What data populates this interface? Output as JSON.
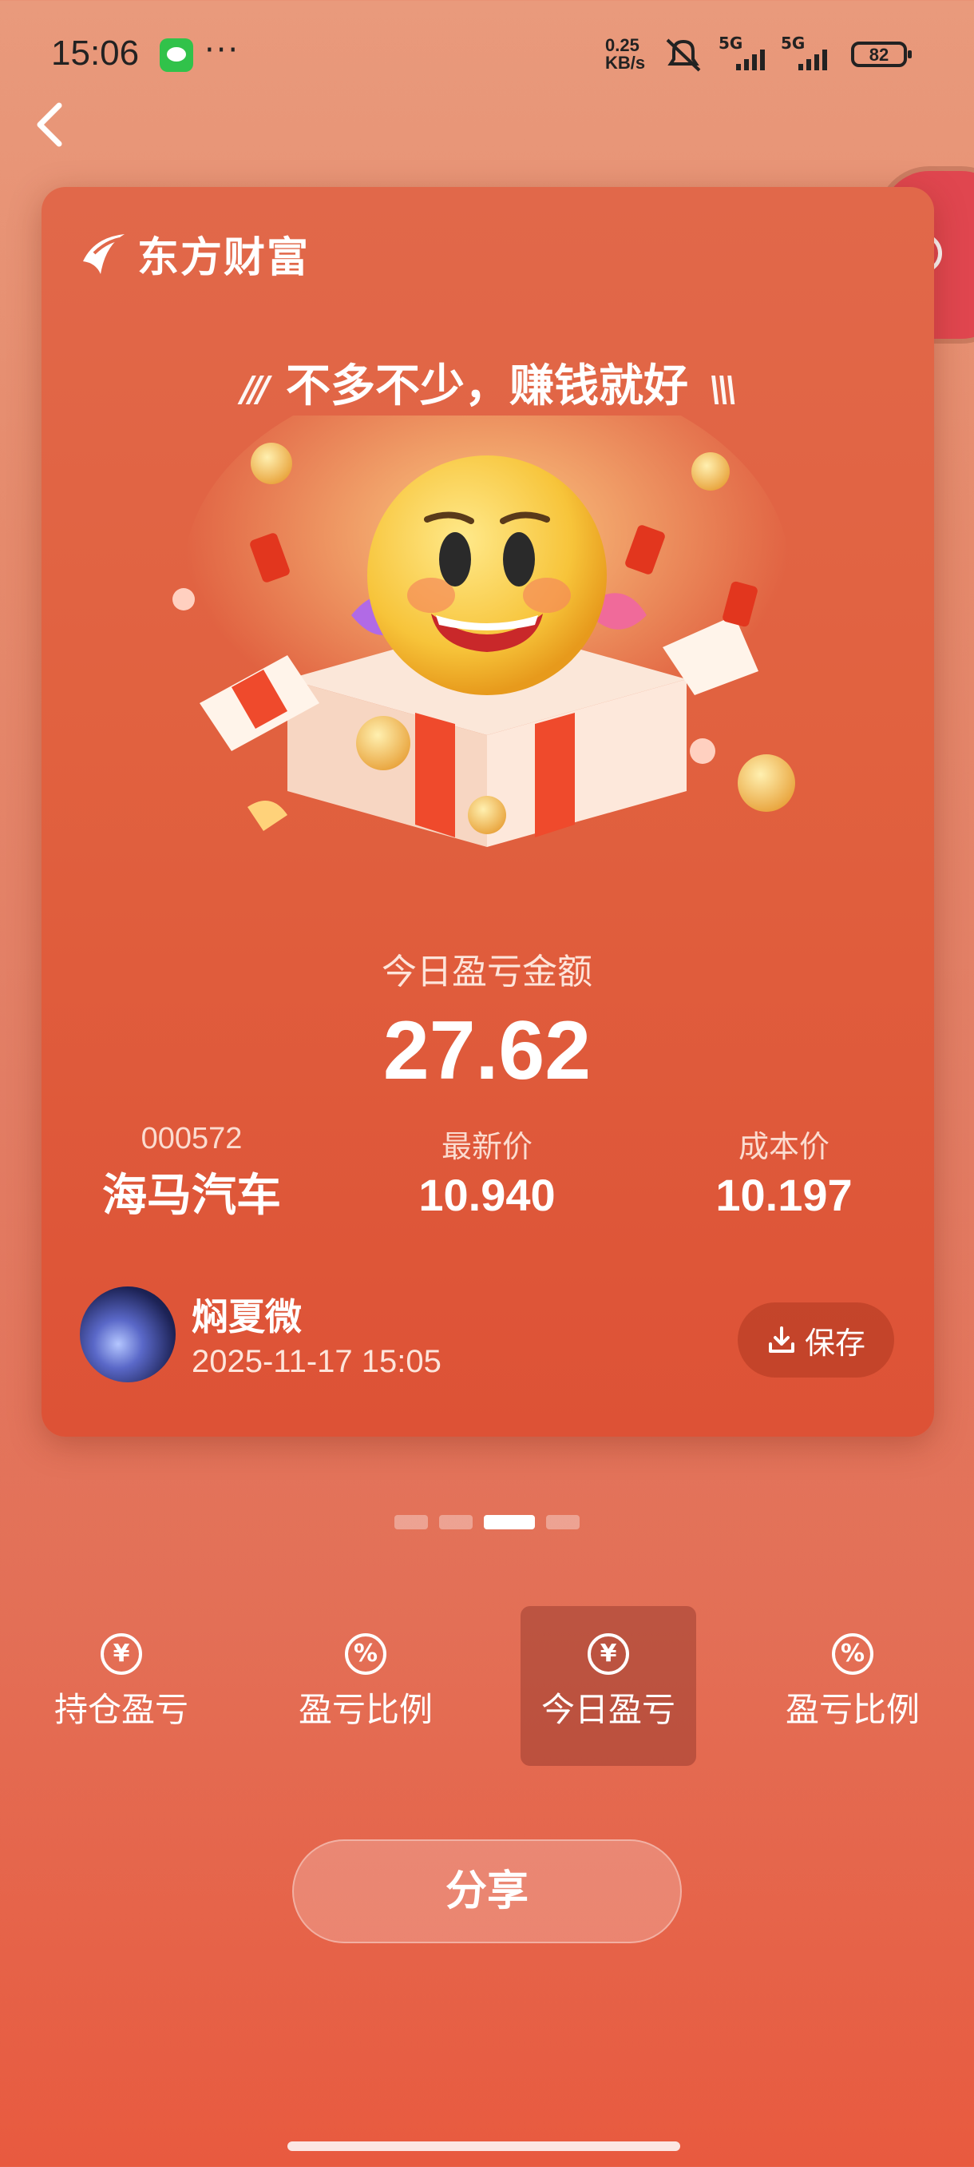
{
  "status_bar": {
    "time": "15:06",
    "net_speed_value": "0.25",
    "net_speed_unit": "KB/s",
    "signal_1": "5G",
    "signal_2": "5G",
    "battery": "82"
  },
  "card": {
    "brand": "东方财富",
    "slogan": "不多不少，赚钱就好",
    "pnl_label": "今日盈亏金额",
    "pnl_value": "27.62",
    "stock_code": "000572",
    "stock_name": "海马汽车",
    "latest_price_label": "最新价",
    "latest_price": "10.940",
    "cost_price_label": "成本价",
    "cost_price": "10.197",
    "user_name": "焖夏微",
    "timestamp": "2025-11-17 15:05",
    "save_label": "保存"
  },
  "pager": {
    "count": 4,
    "active_index": 2
  },
  "tabs": [
    {
      "label": "持仓盈亏",
      "icon": "¥",
      "active": false
    },
    {
      "label": "盈亏比例",
      "icon": "%",
      "active": false
    },
    {
      "label": "今日盈亏",
      "icon": "¥",
      "active": true
    },
    {
      "label": "盈亏比例",
      "icon": "%",
      "active": false
    }
  ],
  "share_label": "分享",
  "colors": {
    "card_top": "#e1684a",
    "card_bottom": "#dd5236",
    "background": "#e58a6c"
  }
}
